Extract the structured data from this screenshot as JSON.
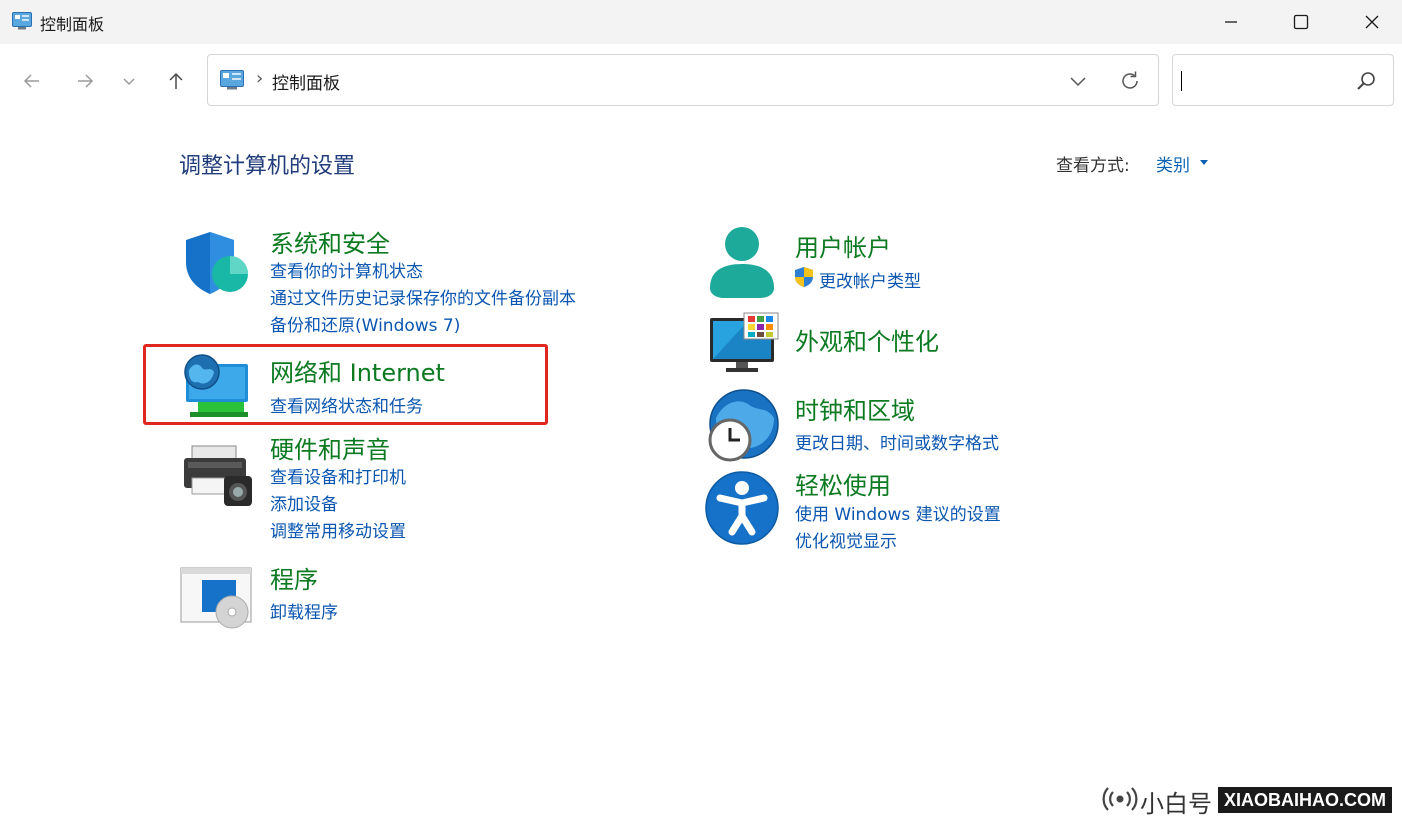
{
  "window": {
    "title": "控制面板",
    "minimize_label": "minimize",
    "maximize_label": "maximize",
    "close_label": "close"
  },
  "navigation": {
    "breadcrumb_separator": "›",
    "address": "控制面板",
    "search_placeholder": ""
  },
  "header": {
    "title": "调整计算机的设置",
    "view_by_label": "查看方式:",
    "view_by_value": "类别"
  },
  "categories_left": [
    {
      "title": "系统和安全",
      "icon": "shield-icon",
      "links": [
        "查看你的计算机状态",
        "通过文件历史记录保存你的文件备份副本",
        "备份和还原(Windows 7)"
      ]
    },
    {
      "title": "网络和 Internet",
      "icon": "network-icon",
      "links": [
        "查看网络状态和任务"
      ]
    },
    {
      "title": "硬件和声音",
      "icon": "printer-icon",
      "links": [
        "查看设备和打印机",
        "添加设备",
        "调整常用移动设置"
      ]
    },
    {
      "title": "程序",
      "icon": "programs-icon",
      "links": [
        "卸载程序"
      ]
    }
  ],
  "categories_right": [
    {
      "title": "用户帐户",
      "icon": "user-icon",
      "links": [
        "更改帐户类型"
      ]
    },
    {
      "title": "外观和个性化",
      "icon": "monitor-icon",
      "links": []
    },
    {
      "title": "时钟和区域",
      "icon": "clock-globe-icon",
      "links": [
        "更改日期、时间或数字格式"
      ]
    },
    {
      "title": "轻松使用",
      "icon": "accessibility-icon",
      "links": [
        "使用 Windows 建议的设置",
        "优化视觉显示"
      ]
    }
  ],
  "footer": {
    "brand": "小白号",
    "site": "XIAOBAIHAO.COM"
  },
  "colors": {
    "category_title": "#0c7a21",
    "link": "#0a56b0",
    "highlight_box": "#e0261f"
  }
}
